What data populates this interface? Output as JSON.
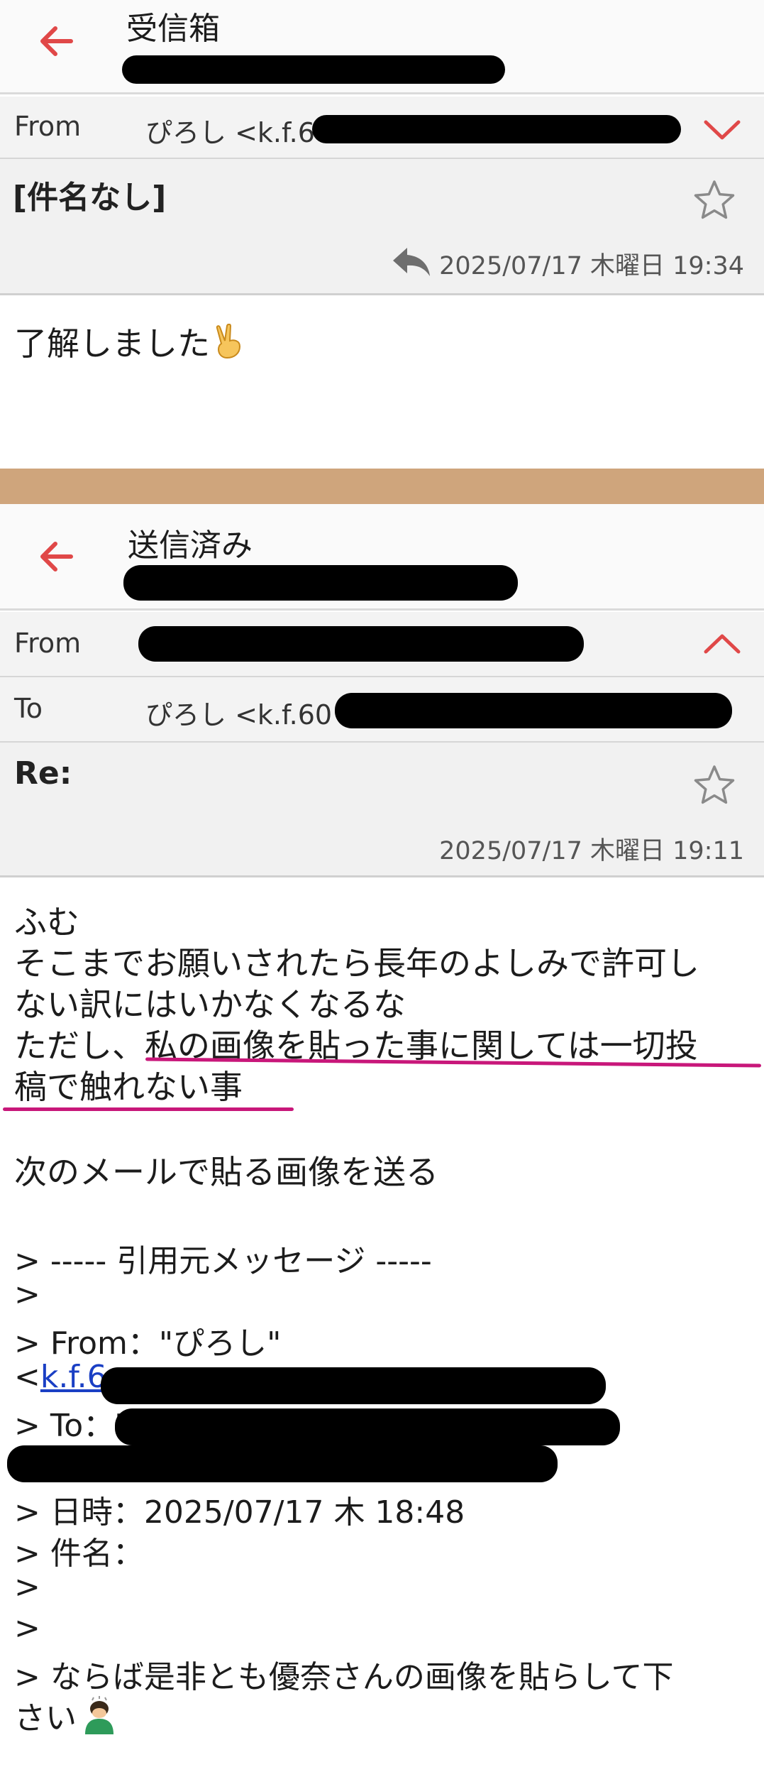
{
  "inbox": {
    "title": "受信箱",
    "from_label": "From",
    "from_value": "ぴろし <k.f.6",
    "subject": "[件名なし]",
    "date": "2025/07/17 木曜日 19:34",
    "body": "了解しました"
  },
  "sent": {
    "title": "送信済み",
    "from_label": "From",
    "to_label": "To",
    "to_value": "ぴろし <k.f.60",
    "subject": "Re:",
    "date": "2025/07/17 木曜日 19:11",
    "body_lines": [
      "ふむ",
      "そこまでお願いされたら長年のよしみで許可し",
      "ない訳にはいかなくなるな",
      "ただし、私の画像を貼った事に関しては一切投",
      "稿で触れない事",
      "",
      "次のメールで貼る画像を送る"
    ],
    "quote": {
      "header": "> ----- 引用元メッセージ -----",
      "blank1": ">",
      "from_line": "> From：\"ぴろし\"",
      "link_prefix": "<",
      "link_text": "k.f.6",
      "to_line": "> To：\"",
      "date_line": "> 日時：2025/07/17 木 18:48",
      "subject_line": "> 件名：",
      "blank2": ">",
      "blank3": ">",
      "msg_line1": "> ならば是非とも優奈さんの画像を貼らして下",
      "msg_line2": "さい"
    }
  },
  "colors": {
    "accent_red": "#e04848",
    "underline_magenta": "#c8177a",
    "divider_band": "#cfa57c"
  },
  "icons": {
    "back": "arrow-left-icon",
    "chevron_down": "chevron-down-icon",
    "chevron_up": "chevron-up-icon",
    "star": "star-outline-icon",
    "reply": "reply-icon",
    "victory_emoji": "victory-hand-emoji",
    "bowing_emoji": "bowing-person-emoji"
  }
}
